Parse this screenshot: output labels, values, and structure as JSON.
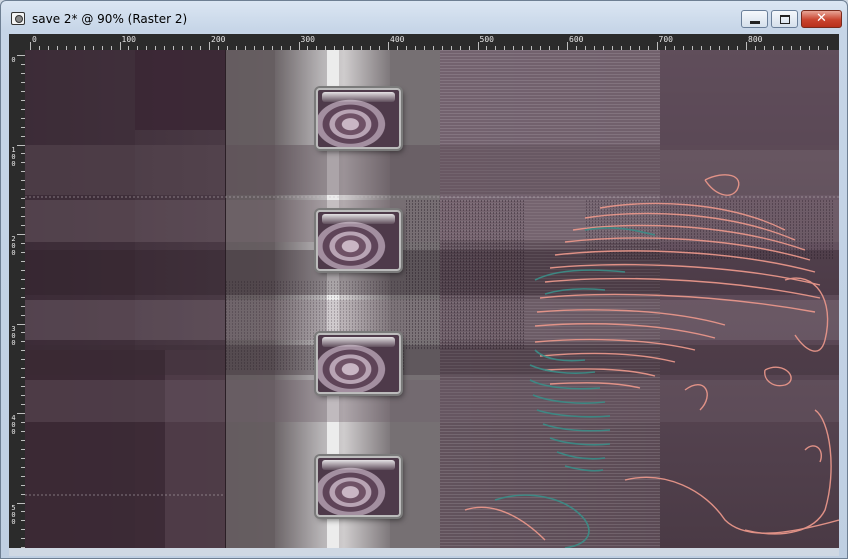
{
  "window": {
    "title": "save 2* @  90% (Raster 2)",
    "buttons": {
      "minimize": "minimize",
      "maximize": "maximize",
      "close": "close",
      "close_glyph": "✕"
    },
    "icons": {
      "app": "camera-app-icon",
      "minimize": "minimize-icon",
      "maximize": "maximize-icon",
      "close": "close-icon"
    }
  },
  "ruler": {
    "top_labels": [
      "0",
      "100",
      "200",
      "300",
      "400",
      "500",
      "600",
      "700",
      "800"
    ],
    "left_labels": [
      "0",
      "100",
      "200",
      "300",
      "400",
      "500"
    ]
  },
  "canvas": {
    "palette": {
      "base": "#4a3a44",
      "plum_dark": "#3f2f3a",
      "mauve": "#6e5a68",
      "grey_band": "#9a9598",
      "light_band": "#c9c7c8",
      "white_line": "#ececec",
      "salmon_outline": "#e8968a",
      "teal_outline": "#3c8b86"
    },
    "thumbnails_count": 4
  }
}
